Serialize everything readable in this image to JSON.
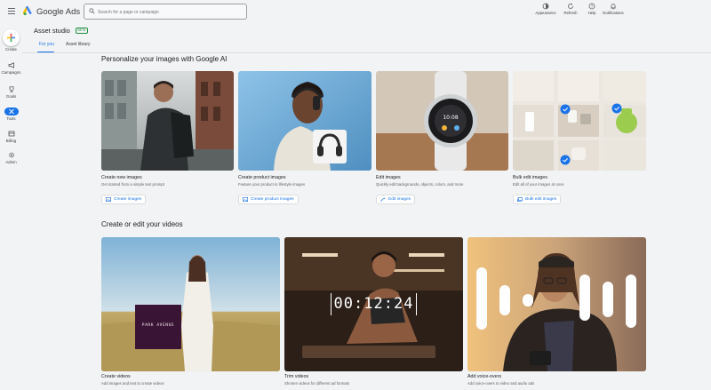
{
  "app": {
    "brand": "Google Ads"
  },
  "search": {
    "placeholder": "Search for a page or campaign"
  },
  "top_actions": [
    {
      "label": "Appearance",
      "icon": "appearance-icon"
    },
    {
      "label": "Refresh",
      "icon": "refresh-icon"
    },
    {
      "label": "Help",
      "icon": "help-icon"
    },
    {
      "label": "Notifications",
      "icon": "bell-icon"
    }
  ],
  "rail": {
    "create_label": "Create",
    "items": [
      {
        "label": "Campaigns",
        "icon": "megaphone-icon",
        "active": false
      },
      {
        "label": "Goals",
        "icon": "trophy-icon",
        "active": false
      },
      {
        "label": "Tools",
        "icon": "tools-icon",
        "active": true
      },
      {
        "label": "Billing",
        "icon": "billing-icon",
        "active": false
      },
      {
        "label": "Admin",
        "icon": "gear-icon",
        "active": false
      }
    ]
  },
  "header": {
    "title": "Asset studio",
    "badge": "BETA"
  },
  "tabs": [
    {
      "label": "For you",
      "active": true
    },
    {
      "label": "Asset library",
      "active": false
    }
  ],
  "images_section": {
    "title": "Personalize your images with Google AI",
    "cards": [
      {
        "title": "Create new images",
        "description": "Get started from a simple text prompt",
        "button": "Create images",
        "image": "man-with-backpack-street"
      },
      {
        "title": "Create product images",
        "description": "Feature your product in lifestyle images",
        "button": "Create product images",
        "image": "woman-with-headphones"
      },
      {
        "title": "Edit images",
        "description": "Quickly edit backgrounds, objects, colors, and more",
        "button": "Edit images",
        "image": "smartwatch"
      },
      {
        "title": "Bulk edit images",
        "description": "Edit all of your images at once",
        "button": "Bulk edit images",
        "image": "product-grid-selected"
      }
    ]
  },
  "videos_section": {
    "title": "Create or edit your videos",
    "cards": [
      {
        "title": "Create videos",
        "description": "Add images and text to create videos",
        "image": "woman-in-field",
        "overlay_text": "PARK AVENUE"
      },
      {
        "title": "Trim videos",
        "description": "Shorten videos for different ad formats",
        "image": "woman-gym-plank",
        "overlay_text": "00:12:24"
      },
      {
        "title": "Add voice-overs",
        "description": "Add voice-overs to video and audio ads",
        "image": "man-with-camera-soundwave"
      }
    ]
  },
  "colors": {
    "accent": "#1a73e8",
    "background": "#f1f3f4",
    "beta_badge": "#1e8e3e"
  }
}
